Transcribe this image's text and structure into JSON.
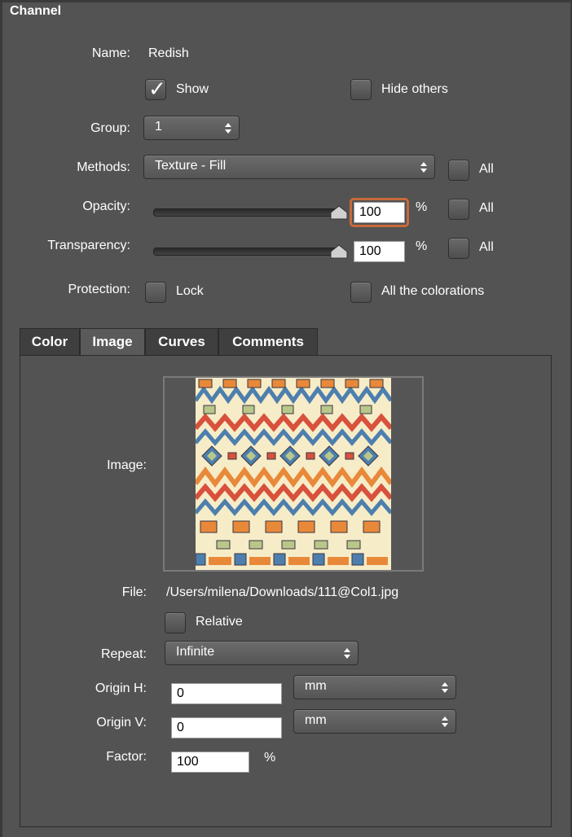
{
  "window": {
    "title": "Channel"
  },
  "fields": {
    "name_label": "Name:",
    "name_value": "Redish",
    "show_label": "Show",
    "show_checked": true,
    "hide_others_label": "Hide others",
    "group_label": "Group:",
    "group_value": "1",
    "methods_label": "Methods:",
    "methods_value": "Texture - Fill",
    "all_label": "All",
    "opacity_label": "Opacity:",
    "opacity_value": "100",
    "opacity_percent": 100,
    "percent_sign": "%",
    "transparency_label": "Transparency:",
    "transparency_value": "100",
    "transparency_percent": 100,
    "protection_label": "Protection:",
    "lock_label": "Lock",
    "all_colorations_label": "All the colorations"
  },
  "tabs": [
    {
      "label": "Color",
      "active": false
    },
    {
      "label": "Image",
      "active": true
    },
    {
      "label": "Curves",
      "active": false
    },
    {
      "label": "Comments",
      "active": false
    }
  ],
  "image_panel": {
    "image_label": "Image:",
    "file_label": "File:",
    "file_path": "/Users/milena/Downloads/111@Col1.jpg",
    "relative_label": "Relative",
    "repeat_label": "Repeat:",
    "repeat_value": "Infinite",
    "origin_h_label": "Origin H:",
    "origin_h_value": "0",
    "origin_h_unit": "mm",
    "origin_v_label": "Origin V:",
    "origin_v_value": "0",
    "origin_v_unit": "mm",
    "factor_label": "Factor:",
    "factor_value": "100",
    "factor_unit": "%"
  },
  "colors": {
    "background": "#535353",
    "focus_ring": "#c76a3a",
    "pattern_cream": "#f6ecc8",
    "pattern_orange": "#e8893a",
    "pattern_red": "#d8513c",
    "pattern_blue": "#4d7fae",
    "pattern_green": "#b9c78a",
    "pattern_dark": "#3b3540"
  }
}
